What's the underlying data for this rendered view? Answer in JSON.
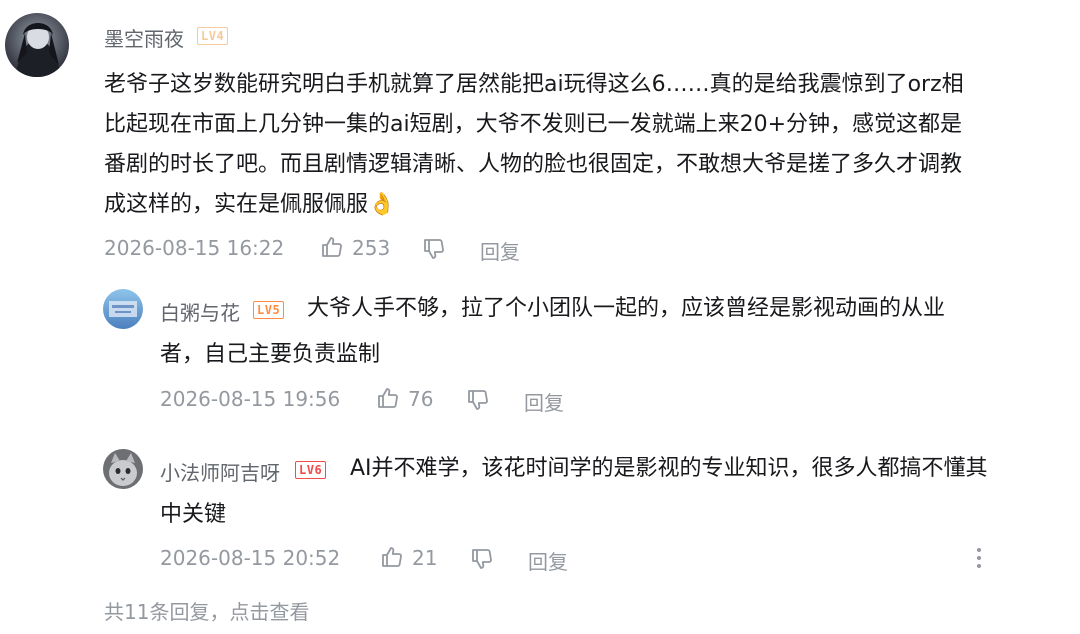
{
  "main_comment": {
    "username": "墨空雨夜",
    "level": "LV4",
    "lines": [
      "老爷子这岁数能研究明白手机就算了居然能把ai玩得这么6……真的是给我震惊到了orz相",
      "比起现在市面上几分钟一集的ai短剧，大爷不发则已一发就端上来20+分钟，感觉这都是",
      "番剧的时长了吧。而且剧情逻辑清晰、人物的脸也很固定，不敢想大爷是搓了多久才调教",
      "成这样的，实在是佩服佩服"
    ],
    "emoji": "👌",
    "timestamp": "2026-08-15 16:22",
    "likes": "253",
    "reply_label": "回复"
  },
  "replies": [
    {
      "username": "白粥与花",
      "level": "LV5",
      "line1": "大爷人手不够，拉了个小团队一起的，应该曾经是影视动画的从业",
      "line2": "者，自己主要负责监制",
      "timestamp": "2026-08-15 19:56",
      "likes": "76",
      "reply_label": "回复"
    },
    {
      "username": "小法师阿吉呀",
      "level": "LV6",
      "line1": "AI并不难学，该花时间学的是影视的专业知识，很多人都搞不懂其",
      "line2": "中关键",
      "timestamp": "2026-08-15 20:52",
      "likes": "21",
      "reply_label": "回复"
    }
  ],
  "more_replies": "共11条回复，点击查看",
  "icons": {
    "like": "thumbs-up-icon",
    "dislike": "thumbs-down-icon",
    "more": "more-vertical-icon"
  },
  "colors": {
    "username": "#61666d",
    "meta": "#9499a0",
    "text": "#18191c",
    "lv4": "#f6c99a",
    "lv5": "#ff8c42",
    "lv6": "#f04c49"
  }
}
